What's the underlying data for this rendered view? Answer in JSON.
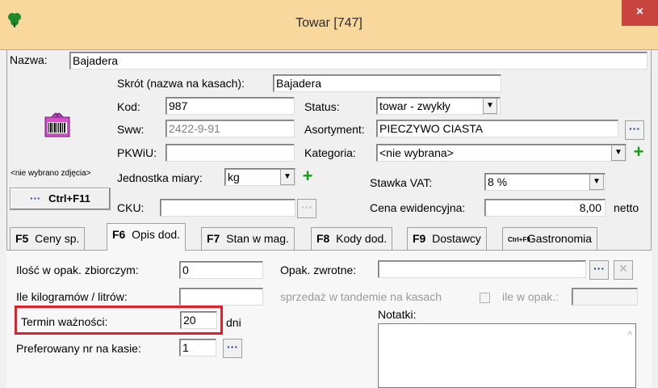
{
  "window": {
    "title": "Towar [747]",
    "close_glyph": "×"
  },
  "form": {
    "nazwa_label": "Nazwa:",
    "nazwa_value": "Bajadera",
    "skrot_label": "Skrót (nazwa na kasach):",
    "skrot_value": "Bajadera",
    "kod_label": "Kod:",
    "kod_value": "987",
    "sww_label": "Sww:",
    "sww_value": "2422-9-91",
    "pkwiu_label": "PKWiU:",
    "pkwiu_value": "",
    "status_label": "Status:",
    "status_value": "towar - zwykły",
    "asortyment_label": "Asortyment:",
    "asortyment_value": "PIECZYWO CIASTA",
    "kategoria_label": "Kategoria:",
    "kategoria_value": "<nie wybrana>",
    "photo_caption": "<nie wybrano zdjęcia>",
    "photo_button": "Ctrl+F11",
    "photo_button_dots": "···",
    "jednostka_label": "Jednostka miary:",
    "jednostka_value": "kg",
    "cku_label": "CKU:",
    "cku_value": "",
    "vat_label": "Stawka VAT:",
    "vat_value": "8 %",
    "cena_label": "Cena ewidencyjna:",
    "cena_value": "8,00",
    "cena_suffix": "netto"
  },
  "tabs": [
    {
      "key": "F5",
      "label": "Ceny sp."
    },
    {
      "key": "F6",
      "label": "Opis dod."
    },
    {
      "key": "F7",
      "label": "Stan w mag."
    },
    {
      "key": "F8",
      "label": "Kody dod."
    },
    {
      "key": "F9",
      "label": "Dostawcy"
    },
    {
      "key": "Ctrl+F9",
      "label": "Gastronomia"
    }
  ],
  "panel": {
    "ilosc_label": "Ilość w opak. zbiorczym:",
    "ilosc_value": "0",
    "kg_label": "Ile kilogramów / litrów:",
    "kg_value": "",
    "termin_label": "Termin ważności:",
    "termin_value": "20",
    "termin_unit": "dni",
    "pref_label": "Preferowany nr na kasie:",
    "pref_value": "1",
    "opak_label": "Opak. zwrotne:",
    "opak_value": "",
    "tandem_label": "sprzedaż w tandemie na kasach",
    "ile_opak_label": "ile w opak.:",
    "notatki_label": "Notatki:"
  },
  "icons": {
    "app": "green-clover-icon",
    "product": "gift-barcode-icon",
    "dropdown": "▼",
    "plus": "+",
    "dots": "···",
    "clear": "✕"
  },
  "colors": {
    "titlebar": "#f8d89c",
    "close": "#c7453d",
    "highlight": "#e0202a",
    "plus": "#1a9a1a",
    "dots": "#1a3aa0"
  }
}
